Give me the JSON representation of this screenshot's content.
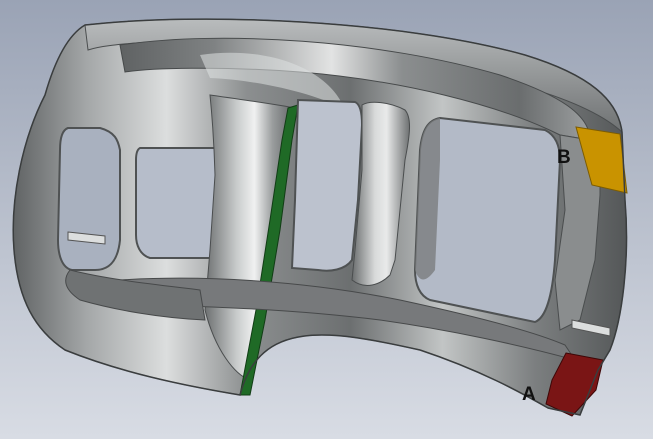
{
  "scene": {
    "label_a": "A",
    "label_b": "B"
  },
  "colors": {
    "background_top": "#9aa3b5",
    "background_bottom": "#d8dce4",
    "metal_dark": "#55585a",
    "metal_mid": "#8d9092",
    "metal_light": "#d4d6d6",
    "edge_green": "#1f6a26",
    "face_a_red": "#7a1515",
    "face_b_yellow": "#c99300",
    "label": "#111111"
  },
  "icons": {
    "face_a": "red-face-marker",
    "face_b": "yellow-face-marker",
    "edge": "green-edge-marker"
  }
}
